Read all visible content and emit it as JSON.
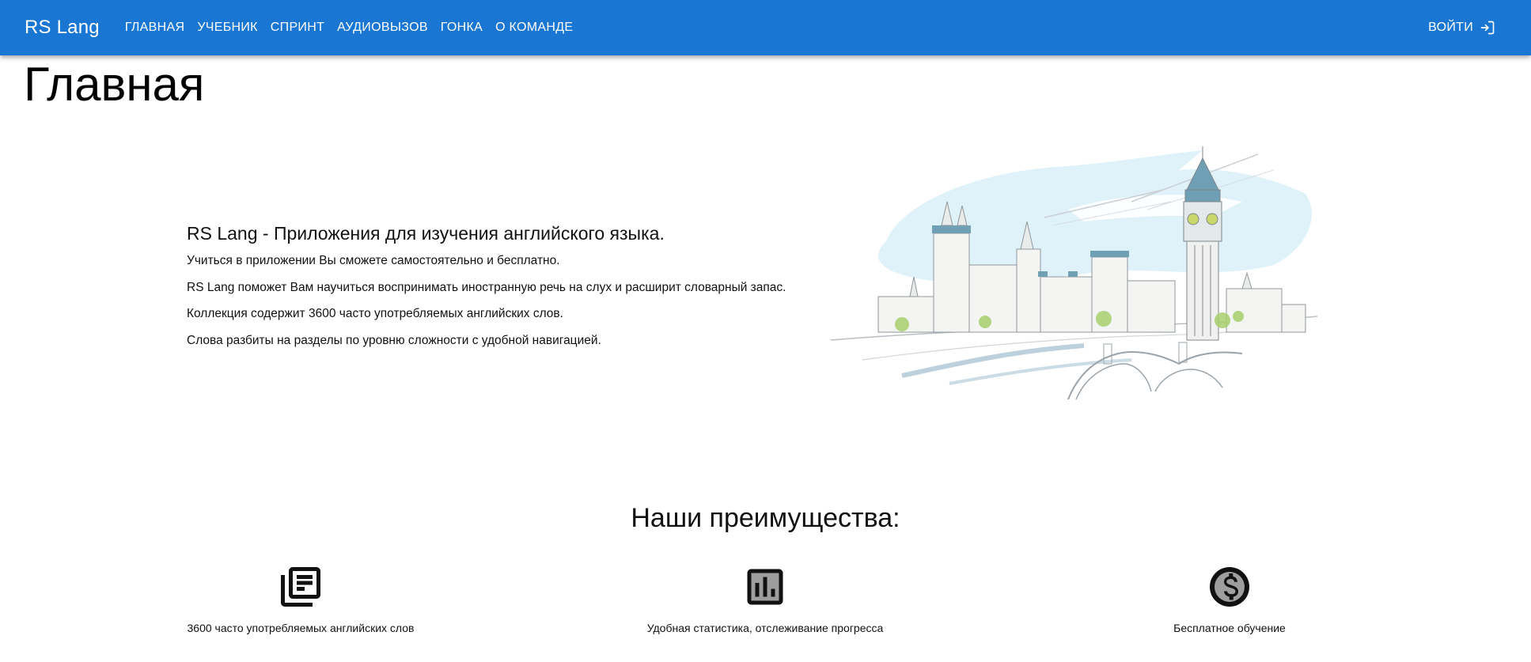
{
  "header": {
    "brand": "RS Lang",
    "nav": [
      {
        "label": "Главная"
      },
      {
        "label": "Учебник"
      },
      {
        "label": "Спринт"
      },
      {
        "label": "Аудиовызов"
      },
      {
        "label": "Гонка"
      },
      {
        "label": "О команде"
      }
    ],
    "login_label": "Войти",
    "login_icon": "login-icon",
    "background_color": "#1976d2"
  },
  "main": {
    "title": "Главная",
    "intro": {
      "heading": "RS Lang - Приложения для изучения английского языка.",
      "paragraphs": [
        "Учиться в приложении Вы сможете самостоятельно и бесплатно.",
        "RS Lang поможет Вам научиться воспринимать иностранную речь на слух и расширит словарный запас.",
        "Коллекция содержит 3600 часто употребляемых английских слов.",
        "Слова разбиты на разделы по уровню сложности с удобной навигацией."
      ]
    },
    "illustration": "london-big-ben-illustration"
  },
  "advantages": {
    "title": "Наши преимущества:",
    "items": [
      {
        "icon": "library-books-icon",
        "caption": "3600 часто употребляемых английских слов"
      },
      {
        "icon": "bar-chart-icon",
        "caption": "Удобная статистика, отслеживание прогресса"
      },
      {
        "icon": "dollar-circle-icon",
        "caption": "Бесплатное обучение"
      }
    ]
  }
}
